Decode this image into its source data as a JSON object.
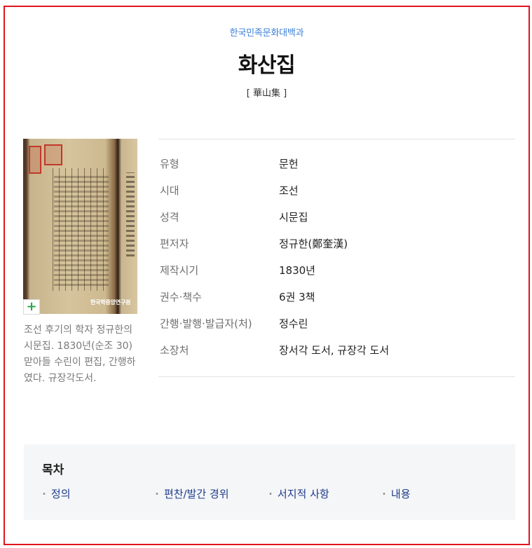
{
  "header": {
    "encyclopedia": "한국민족문화대백과",
    "title": "화산집",
    "hanja": "[ 華山集 ]"
  },
  "thumbnail": {
    "expand_symbol": "+",
    "logo_text": "한국학중앙연구원"
  },
  "summary": "조선 후기의 학자 정규한의 시문집. 1830년(순조 30) 맏아들 수린이 편집, 간행하였다. 규장각도서.",
  "info": [
    {
      "label": "유형",
      "value": "문헌"
    },
    {
      "label": "시대",
      "value": "조선"
    },
    {
      "label": "성격",
      "value": "시문집"
    },
    {
      "label": "편저자",
      "value": "정규한(鄭奎漢)"
    },
    {
      "label": "제작시기",
      "value": "1830년"
    },
    {
      "label": "권수·책수",
      "value": "6권 3책"
    },
    {
      "label": "간행·발행·발급자(처)",
      "value": "정수린"
    },
    {
      "label": "소장처",
      "value": "장서각 도서, 규장각 도서"
    }
  ],
  "toc": {
    "title": "목차",
    "items": [
      "정의",
      "편찬/발간 경위",
      "서지적 사항",
      "내용"
    ]
  },
  "colors": {
    "frame_border": "#e0141e",
    "encyclopedia_link": "#3d80d8",
    "toc_link": "#1d3b8a",
    "expand_icon": "#27a844"
  }
}
